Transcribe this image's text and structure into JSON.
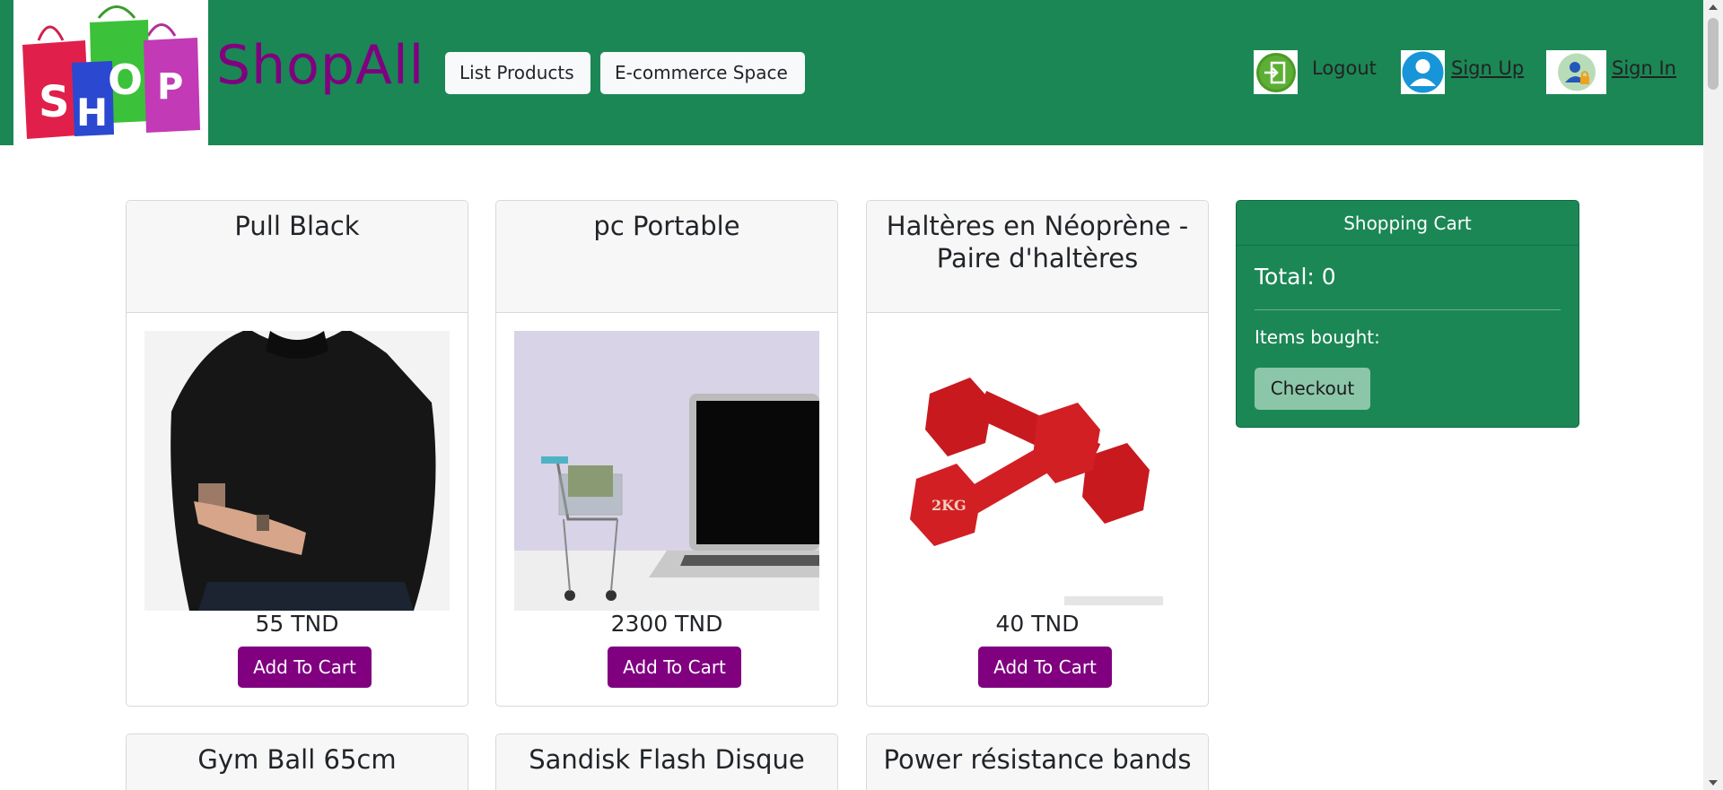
{
  "header": {
    "brand": "ShopAll",
    "logo_letters": [
      "S",
      "H",
      "O",
      "P"
    ],
    "nav": {
      "list_products": "List Products",
      "ecommerce_space": "E-commerce Space"
    },
    "auth": {
      "logout": "Logout",
      "sign_up": " Sign Up",
      "sign_in": " Sign In"
    }
  },
  "products": [
    {
      "title": "Pull Black",
      "price": "55 TND",
      "button": "Add To Cart",
      "icon": "black-sweater-image"
    },
    {
      "title": "pc Portable",
      "price": "2300 TND",
      "button": "Add To Cart",
      "icon": "laptop-cart-image"
    },
    {
      "title": "Haltères en Néoprène - Paire d'haltères",
      "price": "40 TND",
      "button": "Add To Cart",
      "icon": "red-dumbbells-image",
      "image_text": "2KG"
    },
    {
      "title": "Gym Ball 65cm"
    },
    {
      "title": "Sandisk Flash Disque"
    },
    {
      "title": "Power résistance bands"
    }
  ],
  "cart": {
    "title": "Shopping Cart",
    "total": "Total: 0",
    "items_label": "Items bought:",
    "checkout": "Checkout"
  },
  "colors": {
    "header_bg": "#1b8755",
    "brand": "#800080",
    "add_button": "#800080",
    "cart_bg": "#1b8755"
  }
}
